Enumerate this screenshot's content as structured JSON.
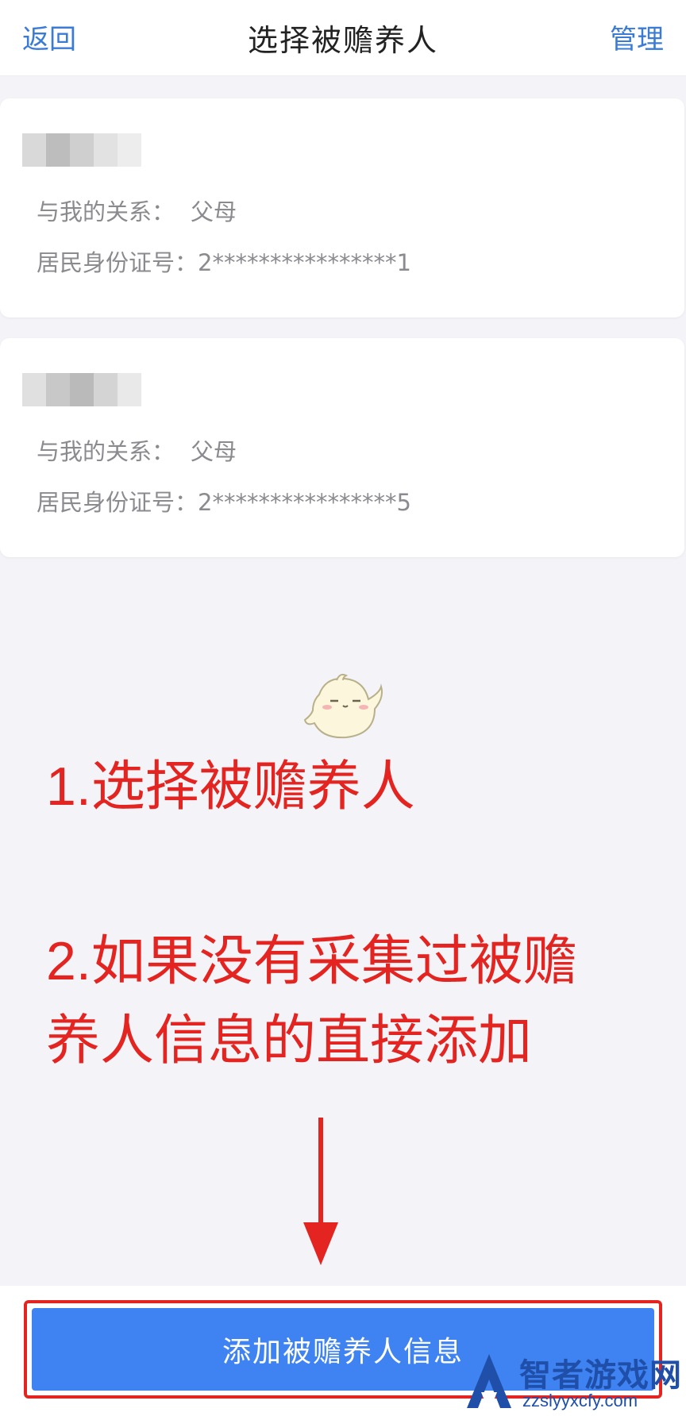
{
  "nav": {
    "back_label": "返回",
    "title": "选择被赡养人",
    "manage_label": "管理"
  },
  "dependents": [
    {
      "relation_label": "与我的关系：",
      "relation_value": "父母",
      "id_label": "居民身份证号：",
      "id_value": "2****************1"
    },
    {
      "relation_label": "与我的关系：",
      "relation_value": "父母",
      "id_label": "居民身份证号：",
      "id_value": "2****************5"
    }
  ],
  "annotation": {
    "line1": "1.选择被赡养人",
    "line2": "2.如果没有采集过被赡",
    "line3": "养人信息的直接添加",
    "color": "#e32420"
  },
  "add_button_label": "添加被赡养人信息",
  "watermark": {
    "cn": "智者游戏网",
    "en": "zzslyyxcfy.com"
  },
  "colors": {
    "accent": "#3a7bd5",
    "button": "#3f83f2"
  }
}
